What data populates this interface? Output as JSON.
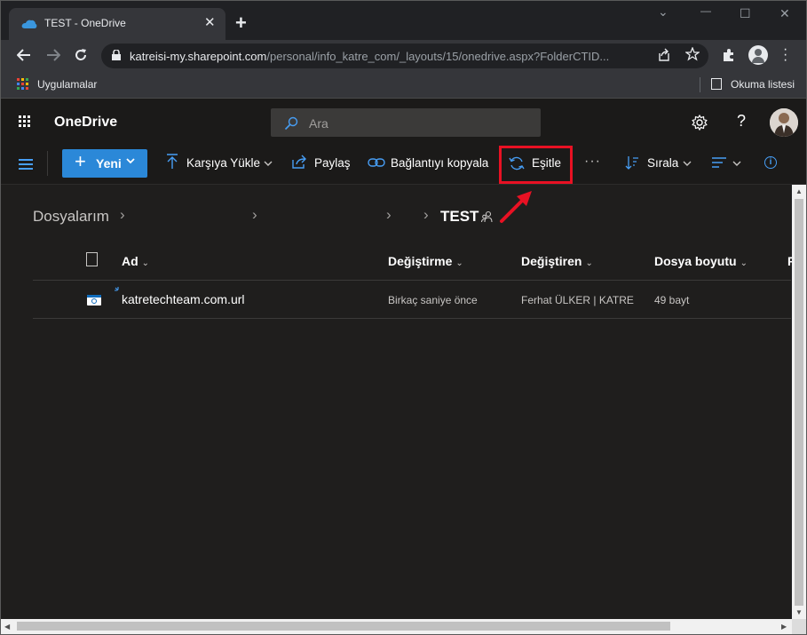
{
  "browser": {
    "tab_title": "TEST - OneDrive",
    "tab_close": "✕",
    "new_tab": "+",
    "window_controls": {
      "minimize": "—",
      "maximize": "☐",
      "close": "✕",
      "tabsearch": "⌄"
    },
    "url_host": "katreisi-my.sharepoint.com",
    "url_path": "/personal/info_katre_com/_layouts/15/onedrive.aspx?FolderCTID...",
    "bookmarks_apps_label": "Uygulamalar",
    "reading_list_label": "Okuma listesi"
  },
  "suite": {
    "app_name": "OneDrive",
    "search_placeholder": "Ara",
    "help": "?"
  },
  "commands": {
    "new_label": "Yeni",
    "upload_label": "Karşıya Yükle",
    "share_label": "Paylaş",
    "copy_link_label": "Bağlantıyı kopyala",
    "sync_label": "Eşitle",
    "more": "···",
    "sort_label": "Sırala"
  },
  "breadcrumb": {
    "root": "Dosyalarım",
    "current": "TEST"
  },
  "columns": {
    "name": "Ad",
    "modified": "Değiştirme",
    "modified_by": "Değiştiren",
    "file_size": "Dosya boyutu",
    "sharing": "P"
  },
  "files": [
    {
      "name": "katretechteam.com.url",
      "modified": "Birkaç saniye önce",
      "modified_by": "Ferhat ÜLKER | KATRE",
      "size": "49 bayt"
    }
  ],
  "colors": {
    "accent": "#2b88d8",
    "highlight": "#e81123",
    "background": "#1f1e1d"
  }
}
